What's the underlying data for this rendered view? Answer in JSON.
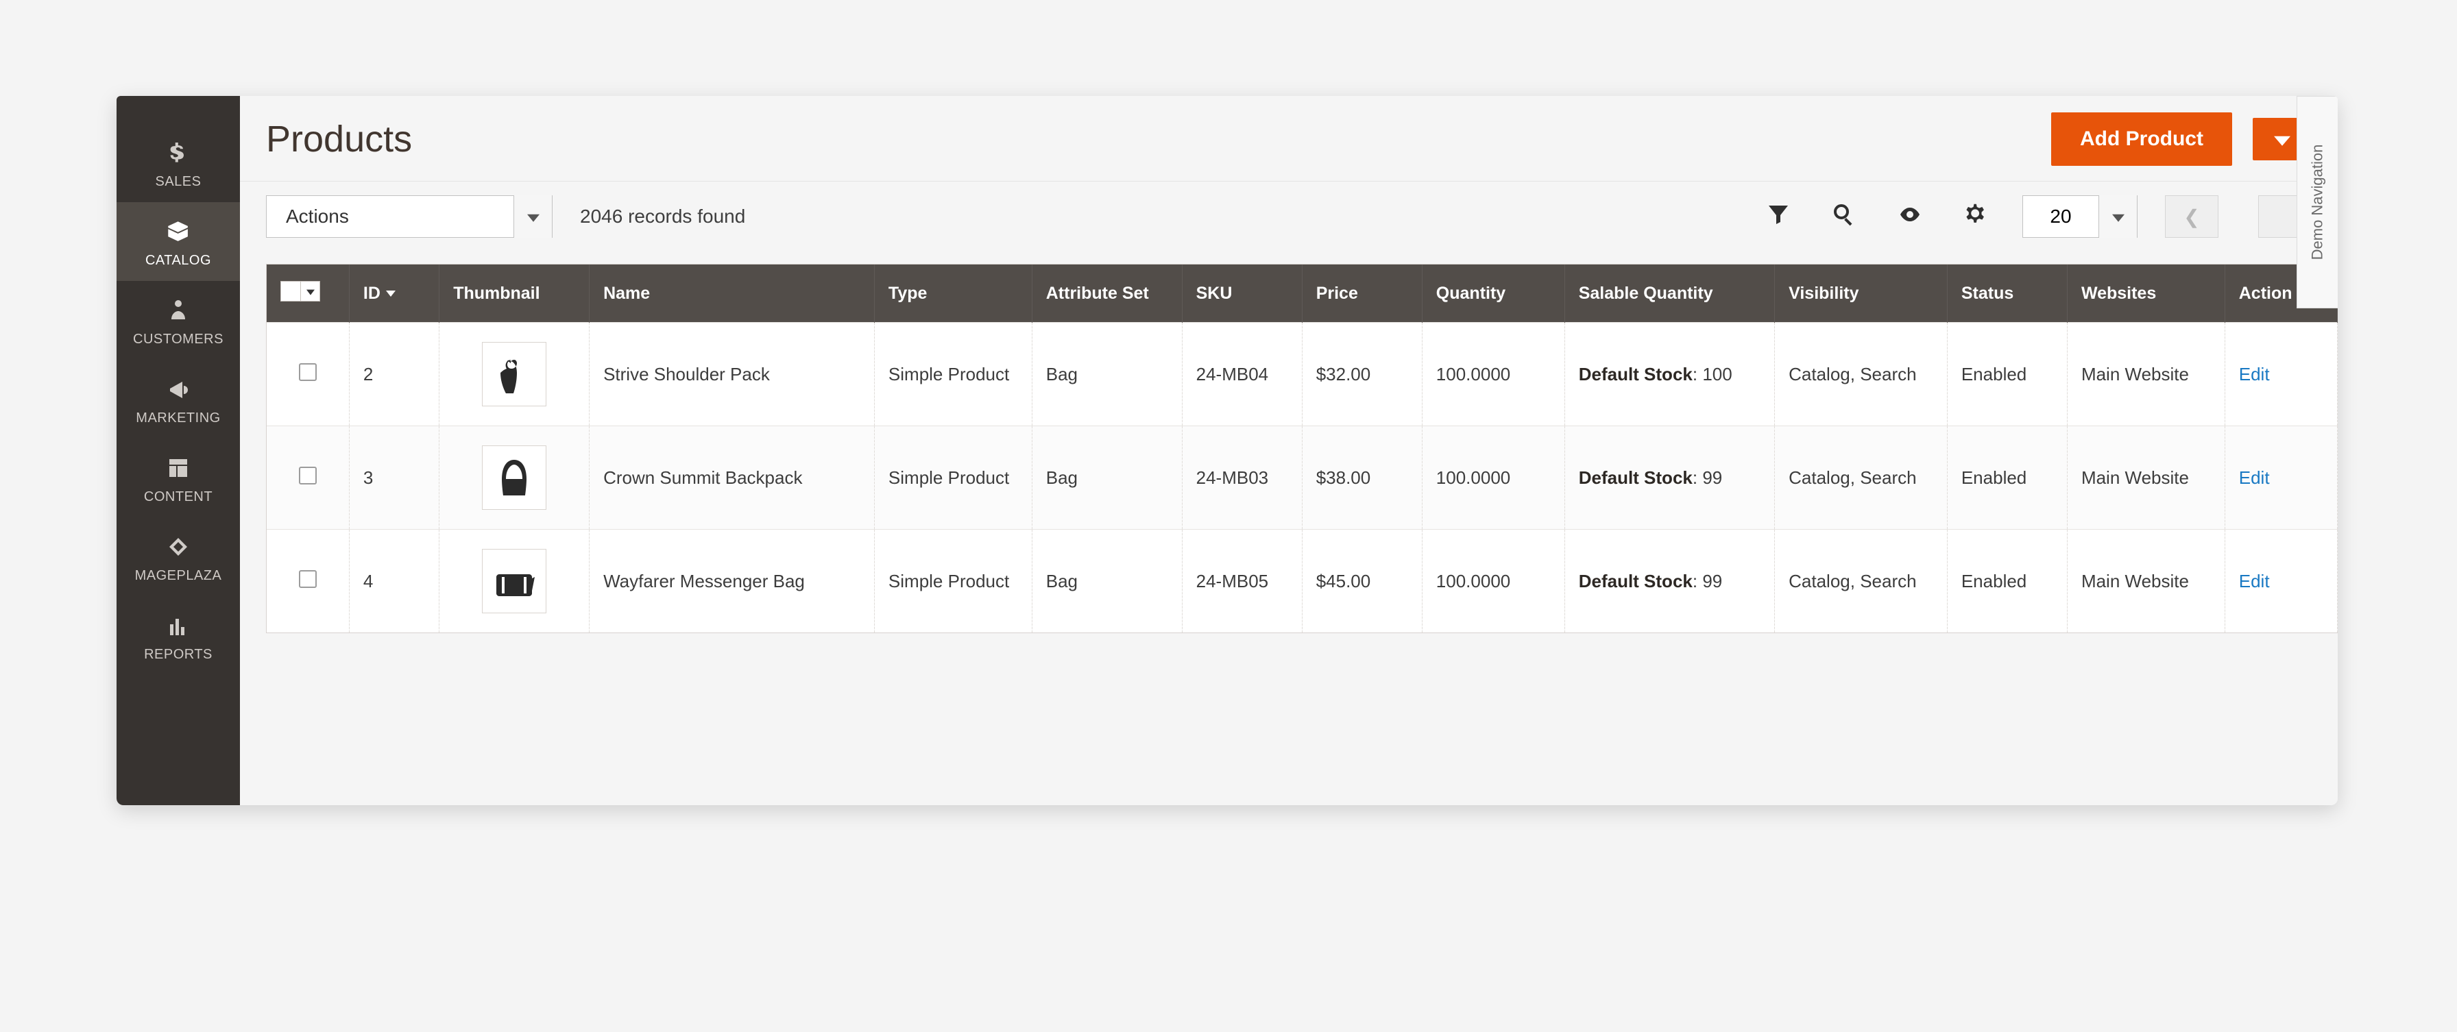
{
  "sidebar": {
    "items": [
      {
        "label": "SALES",
        "icon": "dollar"
      },
      {
        "label": "CATALOG",
        "icon": "box",
        "active": true
      },
      {
        "label": "CUSTOMERS",
        "icon": "person"
      },
      {
        "label": "MARKETING",
        "icon": "megaphone"
      },
      {
        "label": "CONTENT",
        "icon": "layout"
      },
      {
        "label": "MAGEPLAZA",
        "icon": "cross"
      },
      {
        "label": "REPORTS",
        "icon": "bars"
      }
    ]
  },
  "header": {
    "title": "Products",
    "add_button": "Add Product",
    "demo_tab": "Demo Navigation"
  },
  "toolbar": {
    "actions_label": "Actions",
    "records_text": "2046 records found",
    "page_size": "20"
  },
  "columns": {
    "id": "ID",
    "thumbnail": "Thumbnail",
    "name": "Name",
    "type": "Type",
    "attrset": "Attribute Set",
    "sku": "SKU",
    "price": "Price",
    "qty": "Quantity",
    "salqty": "Salable Quantity",
    "visibility": "Visibility",
    "status": "Status",
    "websites": "Websites",
    "action": "Action"
  },
  "rows": [
    {
      "id": "2",
      "name": "Strive Shoulder Pack",
      "type": "Simple Product",
      "attrset": "Bag",
      "sku": "24-MB04",
      "price": "$32.00",
      "qty": "100.0000",
      "sal_label": "Default Stock",
      "sal_qty": "100",
      "visibility": "Catalog, Search",
      "status": "Enabled",
      "websites": "Main Website",
      "edit": "Edit",
      "thumb": "bag1"
    },
    {
      "id": "3",
      "name": "Crown Summit Backpack",
      "type": "Simple Product",
      "attrset": "Bag",
      "sku": "24-MB03",
      "price": "$38.00",
      "qty": "100.0000",
      "sal_label": "Default Stock",
      "sal_qty": "99",
      "visibility": "Catalog, Search",
      "status": "Enabled",
      "websites": "Main Website",
      "edit": "Edit",
      "thumb": "bag2"
    },
    {
      "id": "4",
      "name": "Wayfarer Messenger Bag",
      "type": "Simple Product",
      "attrset": "Bag",
      "sku": "24-MB05",
      "price": "$45.00",
      "qty": "100.0000",
      "sal_label": "Default Stock",
      "sal_qty": "99",
      "visibility": "Catalog, Search",
      "status": "Enabled",
      "websites": "Main Website",
      "edit": "Edit",
      "thumb": "bag3"
    }
  ]
}
